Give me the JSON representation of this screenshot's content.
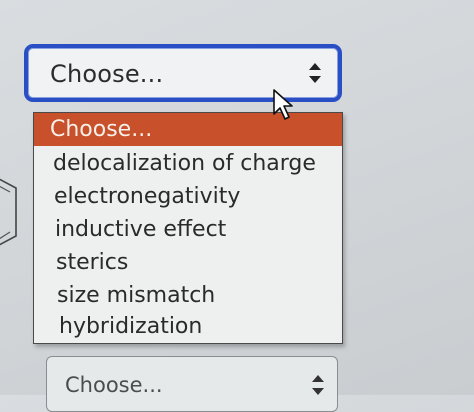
{
  "question_1": {
    "select": {
      "value": "Choose...",
      "caret_icon": "up-down-caret-icon"
    },
    "dropdown": {
      "options": [
        "Choose...",
        "delocalization of charge",
        "electronegativity",
        "inductive effect",
        "sterics",
        "size mismatch",
        "hybridization"
      ],
      "highlighted_index": 0,
      "highlight_color": "#c8502a"
    }
  },
  "question_2": {
    "select": {
      "value": "Choose...",
      "caret_icon": "up-down-caret-icon"
    }
  },
  "cursor_icon": "mouse-pointer-icon",
  "focus_color": "#2a4fc4"
}
